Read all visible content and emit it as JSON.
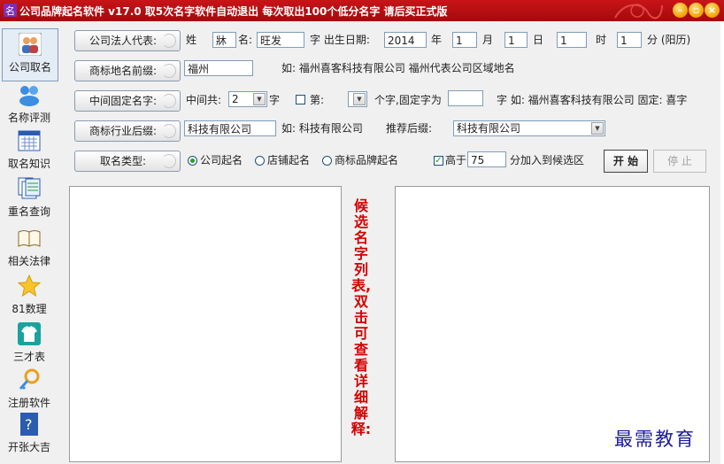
{
  "window": {
    "title": "公司品牌起名软件 v17.0  取5次名字软件自动退出 每次取出100个低分名字 请后买正式版",
    "min_glyph": "–",
    "max_glyph": "▫",
    "close_glyph": "×",
    "title_bg": "#b50f12"
  },
  "sidebar": {
    "items": [
      {
        "label": "公司取名",
        "icon": "people-icon"
      },
      {
        "label": "名称评测",
        "icon": "users-icon"
      },
      {
        "label": "取名知识",
        "icon": "calendar-icon"
      },
      {
        "label": "重名查询",
        "icon": "documents-icon"
      },
      {
        "label": "相关法律",
        "icon": "book-icon"
      },
      {
        "label": "81数理",
        "icon": "star-icon"
      },
      {
        "label": "三才表",
        "icon": "shirt-icon"
      },
      {
        "label": "注册软件",
        "icon": "key-icon"
      },
      {
        "label": "开张大吉",
        "icon": "help-icon"
      }
    ]
  },
  "row1": {
    "button": "公司法人代表:",
    "surname_label": "姓",
    "surname": "牀",
    "name_label": "名:",
    "name": "旺发",
    "birth_label": "字 出生日期:",
    "year": "2014",
    "year_unit": "年",
    "month": "1",
    "month_unit": "月",
    "day": "1",
    "day_unit": "日",
    "hour": "1",
    "hour_unit": "时",
    "minute": "1",
    "minute_unit": "分 (阳历)"
  },
  "row2": {
    "button": "商标地名前缀:",
    "value": "福州",
    "hint": "如: 福州喜客科技有限公司 福州代表公司区域地名"
  },
  "row3": {
    "button": "中间固定名字:",
    "total_label": "中间共:",
    "total_value": "2",
    "char_label": "字",
    "pos_label": "第:",
    "pos_value": "",
    "fixed_label": "个字,固定字为",
    "fixed_value": "",
    "hint": "字 如: 福州喜客科技有限公司 固定: 喜字"
  },
  "row4": {
    "button": "商标行业后缀:",
    "value": "科技有限公司",
    "hint": "如: 科技有限公司",
    "recommend_label": "推荐后缀:",
    "recommend_value": "科技有限公司"
  },
  "row5": {
    "button": "取名类型:",
    "options": [
      "公司起名",
      "店铺起名",
      "商标品牌起名"
    ],
    "selected_index": 0,
    "above_label": "高于",
    "above_checked": true,
    "above_value": "75",
    "above_suffix": "分加入到候选区",
    "start_label": "开 始",
    "stop_label": "停 止"
  },
  "candidate_caption": "候选名字列表,双击可查看详细解释:",
  "watermark": "最需教育"
}
